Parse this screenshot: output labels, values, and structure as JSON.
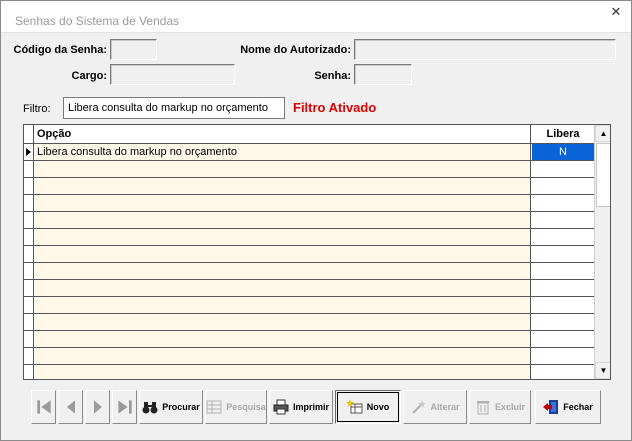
{
  "window": {
    "title": "Senhas do Sistema de Vendas",
    "close_glyph": "✕"
  },
  "form": {
    "codigo_label": "Código da Senha:",
    "codigo_value": "",
    "nome_label": "Nome do Autorizado:",
    "nome_value": "",
    "cargo_label": "Cargo:",
    "cargo_value": "",
    "senha_label": "Senha:",
    "senha_value": ""
  },
  "filter": {
    "label": "Filtro:",
    "value": "Libera consulta do markup no orçamento",
    "status": "Filtro Ativado",
    "status_color": "#e00000"
  },
  "grid": {
    "columns": [
      "Opção",
      "Libera"
    ],
    "rows": [
      {
        "opcao": "Libera consulta do markup no orçamento",
        "libera": "N",
        "selected": true
      }
    ],
    "empty_row_count": 13,
    "selection_color": "#0a64d8",
    "row_bg": "#fdf8e8"
  },
  "toolbar": {
    "first_icon": "first-record-icon",
    "prev_icon": "previous-record-icon",
    "next_icon": "next-record-icon",
    "last_icon": "last-record-icon",
    "procurar": "Procurar",
    "pesquisa": "Pesquisa",
    "imprimir": "Imprimir",
    "novo": "Novo",
    "alterar": "Alterar",
    "excluir": "Excluir",
    "fechar": "Fechar"
  }
}
